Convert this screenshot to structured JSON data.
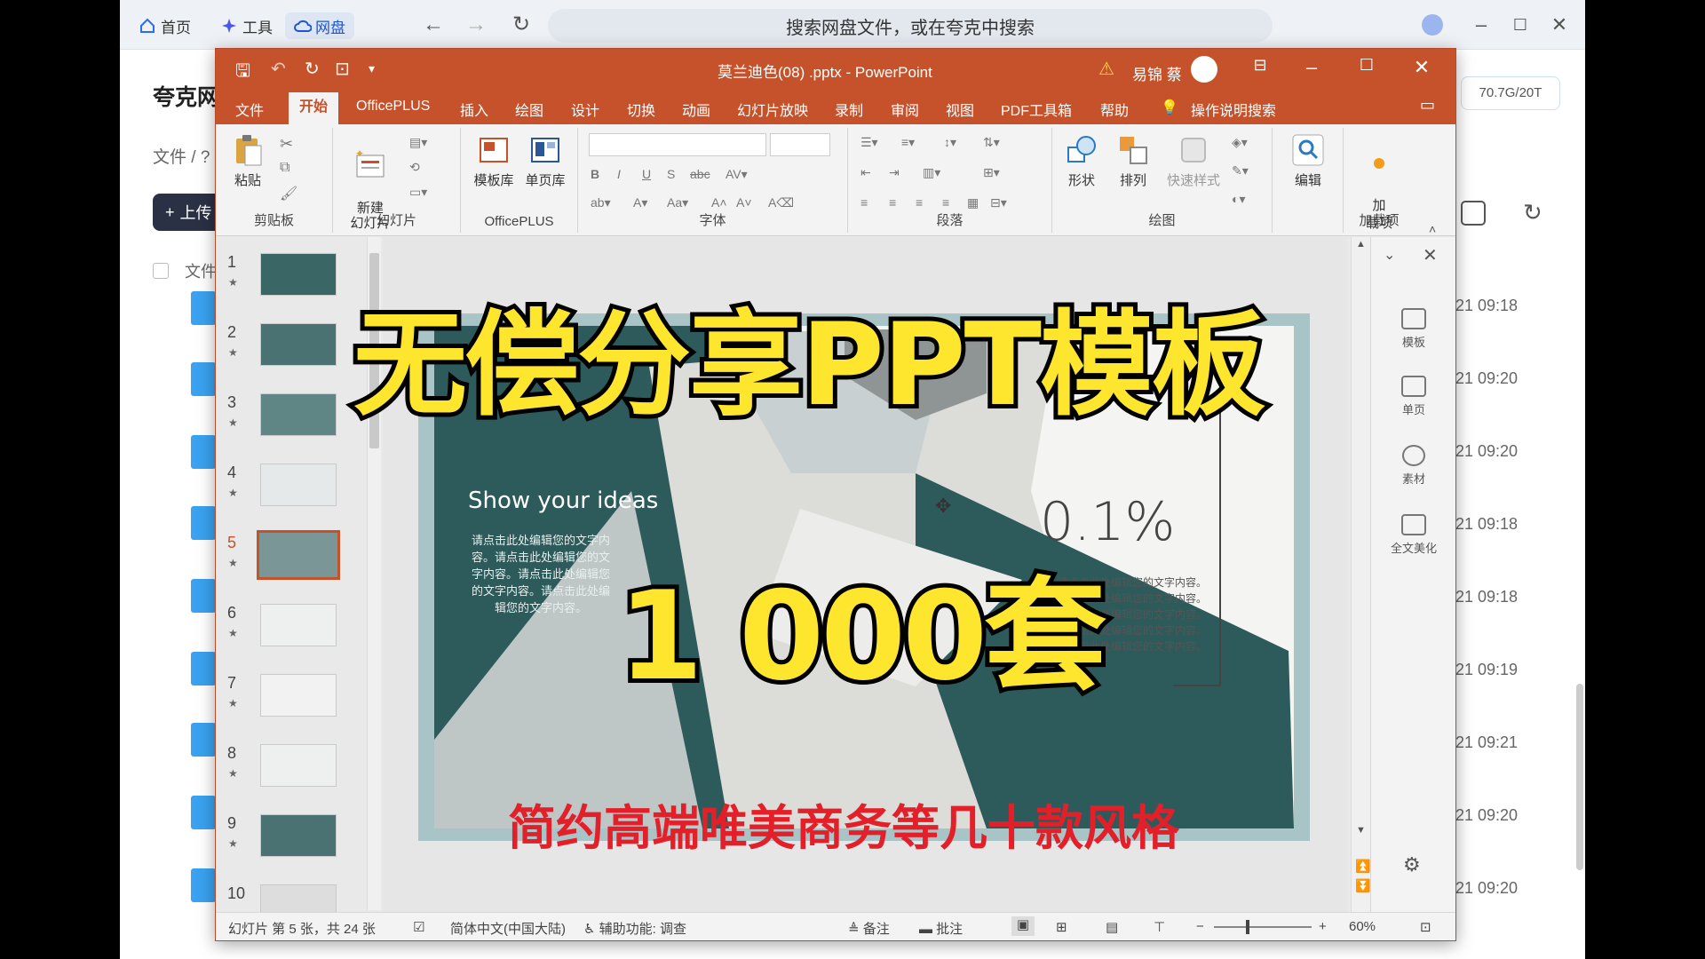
{
  "browser": {
    "tabs": [
      {
        "label": "首页",
        "icon": "home-icon"
      },
      {
        "label": "工具",
        "icon": "tools-icon"
      },
      {
        "label": "网盘",
        "icon": "cloud-drive-icon"
      }
    ],
    "search_placeholder": "搜索网盘文件，或在夸克中搜索",
    "brand": "夸克网",
    "breadcrumb": "文件 / ?",
    "upload_label": "上传",
    "file_header": "文件",
    "storage": "70.7G/20T",
    "times": [
      "21 09:18",
      "21 09:20",
      "21 09:20",
      "21 09:18",
      "21 09:18",
      "21 09:19",
      "21 09:21",
      "21 09:20",
      "21 09:20"
    ]
  },
  "ppt": {
    "title": "莫兰迪色(08) .pptx  -  PowerPoint",
    "user": "易锦 蔡",
    "tabs": [
      "文件",
      "开始",
      "OfficePLUS",
      "插入",
      "绘图",
      "设计",
      "切换",
      "动画",
      "幻灯片放映",
      "录制",
      "审阅",
      "视图",
      "PDF工具箱",
      "帮助",
      "操作说明搜索"
    ],
    "active_tab": "开始",
    "groups": {
      "clipboard": {
        "label": "剪贴板",
        "paste": "粘贴"
      },
      "slides": {
        "label": "幻灯片",
        "new_slide": "新建\n幻灯片"
      },
      "officeplus": {
        "label": "OfficePLUS",
        "template_lib": "模板库",
        "page_lib": "单页库"
      },
      "font": {
        "label": "字体"
      },
      "paragraph": {
        "label": "段落"
      },
      "drawing": {
        "label": "绘图",
        "shapes": "形状",
        "arrange": "排列",
        "quick_styles": "快速样式"
      },
      "editing": {
        "label": "编辑",
        "edit": "编辑"
      },
      "addins": {
        "label": "加载项",
        "addin": "加\n载项"
      }
    },
    "slide_numbers": [
      "1",
      "2",
      "3",
      "4",
      "5",
      "6",
      "7",
      "8",
      "9",
      "10"
    ],
    "current_slide": 5,
    "slide": {
      "heading": "Show your ideas",
      "body_left": "请点击此处编辑您的文字内容。请点击此处编辑您的文字内容。请点击此处编辑您的文字内容。请点击此处编辑您的文字内容。",
      "percent": "0.1%",
      "body_right": "请点击此处编辑您的文字内容。请点击此处编辑您的文字内容。请点击此处编辑您的文字内容。请点击此处编辑您的文字内容。请点击此处编辑您的文字内容。"
    },
    "right_pane": [
      "模板",
      "单页",
      "素材",
      "全文美化"
    ],
    "status": {
      "slide_info": "幻灯片 第 5 张，共 24 张",
      "language": "简体中文(中国大陆)",
      "accessibility": "辅助功能: 调查",
      "notes": "备注",
      "comments": "批注",
      "zoom": "60%"
    },
    "colors": {
      "accent": "#c5522b",
      "slide_teal": "#2d5a5a"
    }
  },
  "overlay": {
    "line1": "无偿分享PPT模板",
    "line2": "1 000套",
    "line3": "简约高端唯美商务等几十款风格"
  }
}
